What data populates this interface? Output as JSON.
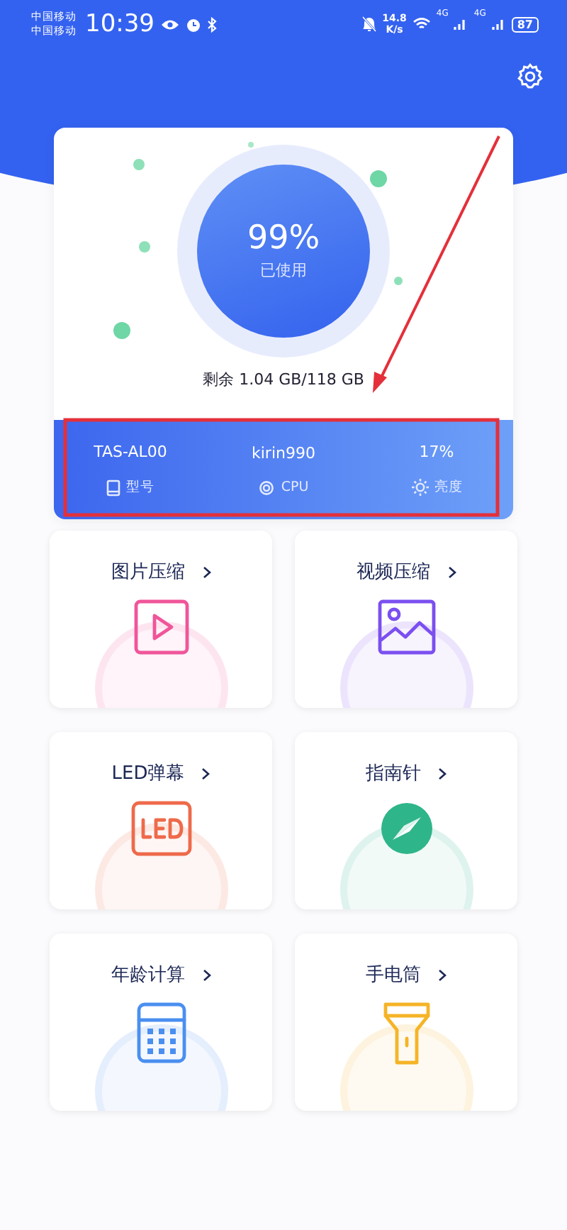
{
  "status_bar": {
    "carriers": [
      "中国移动",
      "中国移动"
    ],
    "time": "10:39",
    "speed_value": "14.8",
    "speed_unit": "K/s",
    "network_1": "4G",
    "network_2": "4G",
    "battery": "87"
  },
  "storage": {
    "percent": "99%",
    "caption": "已使用",
    "remaining": "剩余 1.04 GB/118 GB"
  },
  "device_info": [
    {
      "value": "TAS-AL00",
      "label": "型号",
      "kind": "model"
    },
    {
      "value": "kirin990",
      "label": "CPU",
      "kind": "cpu"
    },
    {
      "value": "17%",
      "label": "亮度",
      "kind": "brightness"
    }
  ],
  "tools": [
    {
      "title": "图片压缩",
      "kind": "play",
      "color": "#f0559a"
    },
    {
      "title": "视频压缩",
      "kind": "image",
      "color": "#7b4ff0"
    },
    {
      "title": "LED弹幕",
      "kind": "led",
      "color": "#ee6a4a"
    },
    {
      "title": "指南针",
      "kind": "compass",
      "color": "#2fb58a"
    },
    {
      "title": "年龄计算",
      "kind": "calculator",
      "color": "#4a8ff0"
    },
    {
      "title": "手电筒",
      "kind": "flashlight",
      "color": "#f5b427"
    }
  ],
  "annotation": {
    "kind": "arrow-box"
  }
}
